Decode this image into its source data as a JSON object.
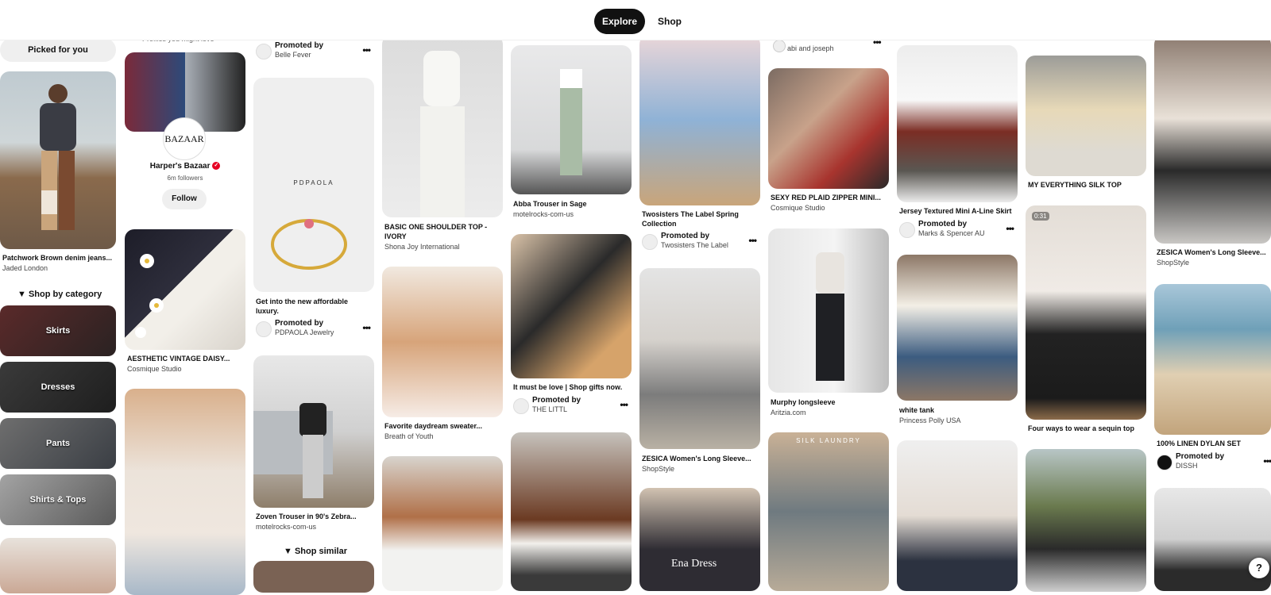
{
  "tabs": {
    "explore": "Explore",
    "shop": "Shop"
  },
  "col1": {
    "picked": "Picked for you",
    "pin1_title": "Patchwork Brown denim jeans...",
    "pin1_source": "Jaded London",
    "shop_category": "Shop by category",
    "categories": [
      "Skirts",
      "Dresses",
      "Pants",
      "Shirts & Tops"
    ]
  },
  "col2": {
    "profiles_header": "Profiles you might love",
    "logo_text": "BAZAAR",
    "profile_name": "Harper's Bazaar",
    "profile_followers": "6m followers",
    "follow": "Follow",
    "pin_title": "AESTHETIC VINTAGE DAISY...",
    "pin_source": "Cosmique Studio"
  },
  "col3": {
    "promo1_label": "Promoted by",
    "promo1_name": "Belle Fever",
    "brand_text": "PDPAOLA",
    "pin_title_1": "Get into the new affordable",
    "pin_title_2": "luxury.",
    "promo2_label": "Promoted by",
    "promo2_name": "PDPAOLA Jewelry",
    "pin2_title": "Zoven Trouser in 90's Zebra...",
    "pin2_source": "motelrocks-com-us",
    "shop_similar": "Shop similar"
  },
  "col4": {
    "pin1_title_1": "BASIC ONE SHOULDER TOP -",
    "pin1_title_2": "IVORY",
    "pin1_source": "Shona Joy International",
    "pin2_title": "Favorite daydream sweater...",
    "pin2_source": "Breath of Youth"
  },
  "col5": {
    "pin1_title": "Abba Trouser in Sage",
    "pin1_source": "motelrocks-com-us",
    "pin2_title": "It must be love | Shop gifts now.",
    "promo_label": "Promoted by",
    "promo_name": "THE LITTL"
  },
  "col6": {
    "pin1_title_1": "Twosisters The Label Spring",
    "pin1_title_2": "Collection",
    "promo_label": "Promoted by",
    "promo_name": "Twosisters The Label",
    "pin2_title": "ZESICA Women's Long Sleeve...",
    "pin2_source": "ShopStyle",
    "pin3_overlay": "Ena Dress"
  },
  "col7": {
    "top_source": "abi and joseph",
    "pin1_title": "SEXY RED PLAID ZIPPER MINI...",
    "pin1_source": "Cosmique Studio",
    "pin2_title": "Murphy longsleeve",
    "pin2_source": "Aritzia.com",
    "pin3_overlay": "SILK LAUNDRY"
  },
  "col8": {
    "pin1_title": "Jersey Textured Mini A-Line Skirt",
    "promo_label": "Promoted by",
    "promo_name": "Marks & Spencer AU",
    "pin2_title": "white tank",
    "pin2_source": "Princess Polly USA"
  },
  "col9": {
    "pin1_title": "MY EVERYTHING SILK TOP",
    "video_time": "0:31",
    "pin2_title": "Four ways to wear a sequin top"
  },
  "col10": {
    "pin1_title": "ZESICA Women's Long Sleeve...",
    "pin1_source": "ShopStyle",
    "pin2_title": "100% LINEN DYLAN SET",
    "promo_label": "Promoted by",
    "promo_name": "DISSH"
  },
  "help": "?",
  "colors": {
    "accent": "#e60023",
    "dark": "#111111"
  }
}
